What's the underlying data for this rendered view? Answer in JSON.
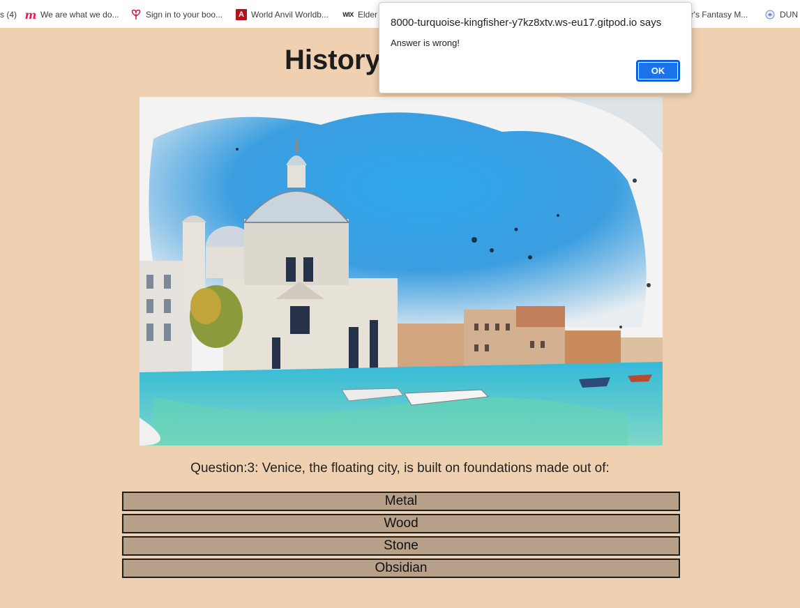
{
  "bookmarks": [
    {
      "label": "s (4)",
      "icon": "none"
    },
    {
      "label": "We are what we do...",
      "icon": "m-logo-icon"
    },
    {
      "label": "Sign in to your boo...",
      "icon": "heart-icon"
    },
    {
      "label": "World Anvil Worldb...",
      "icon": "world-anvil-icon"
    },
    {
      "label": "Elder",
      "icon": "wix-icon",
      "icon_text": "WIX"
    },
    {
      "label": "ar's Fantasy M...",
      "icon": "none"
    },
    {
      "label": "DUN",
      "icon": "globe-icon"
    }
  ],
  "page": {
    "title": "History",
    "image_alt": "Watercolor painting of Santa Maria della Salute, Venice"
  },
  "question": {
    "text": "Question:3: Venice, the floating city, is built on foundations made out of:"
  },
  "answers": [
    "Metal",
    "Wood",
    "Stone",
    "Obsidian"
  ],
  "dialog": {
    "title": "8000-turquoise-kingfisher-y7kz8xtv.ws-eu17.gitpod.io says",
    "message": "Answer is wrong!",
    "ok_label": "OK"
  },
  "colors": {
    "page_background": "#efd0b0",
    "answer_background": "#b8a188",
    "dialog_button": "#1a73e8"
  }
}
